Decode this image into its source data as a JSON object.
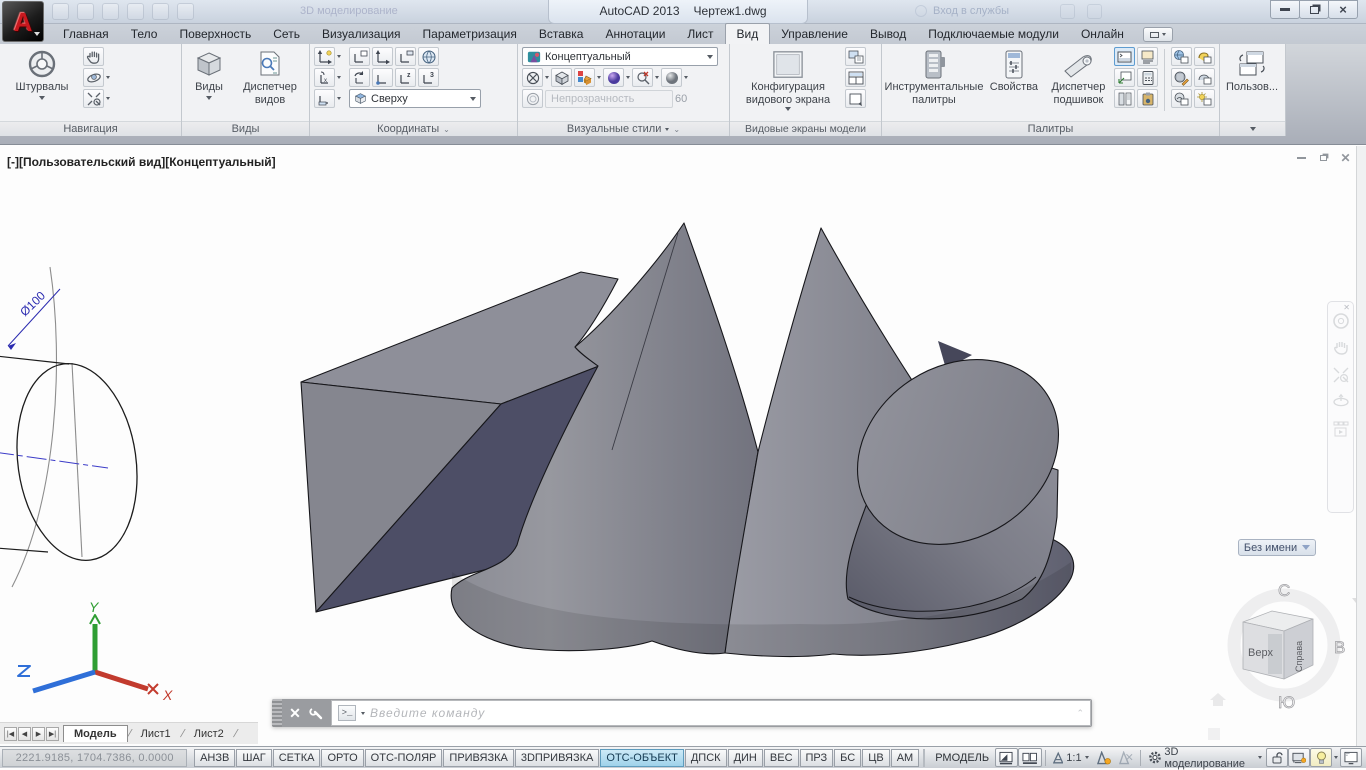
{
  "title_bar": {
    "app_title": "AutoCAD 2013",
    "doc_name": "Чертеж1.dwg",
    "workspace": "3D моделирование",
    "signin": "Вход в службы"
  },
  "ribbon": {
    "tabs": [
      "Главная",
      "Тело",
      "Поверхность",
      "Сеть",
      "Визуализация",
      "Параметризация",
      "Вставка",
      "Аннотации",
      "Лист",
      "Вид",
      "Управление",
      "Вывод",
      "Подключаемые модули",
      "Онлайн"
    ],
    "active_tab": "Вид",
    "panel_navigation": {
      "title": "Навигация",
      "steering_wheels": "Штурвалы"
    },
    "panel_views": {
      "title": "Виды",
      "views": "Виды",
      "view_manager": "Диспетчер видов"
    },
    "panel_coordinates": {
      "title": "Координаты",
      "view_select": "Сверху"
    },
    "panel_visual_styles": {
      "title": "Визуальные стили",
      "style_select": "Концептуальный",
      "opacity_label": "Непрозрачность",
      "opacity_value": "60"
    },
    "panel_model_viewports": {
      "title": "Видовые экраны модели",
      "config": "Конфигурация видового экрана"
    },
    "panel_palettes": {
      "title": "Палитры",
      "tool_palettes": "Инструментальные палитры",
      "properties": "Свойства",
      "sheet_set_manager": "Диспетчер подшивок"
    },
    "panel_user": {
      "user": "Пользов..."
    }
  },
  "viewport": {
    "control_minus": "[-]",
    "control_view": "[Пользовательский вид]",
    "control_style": "[Концептуальный]",
    "dimension_label": "Ø100",
    "viewcube": {
      "ucs_button": "Без имени",
      "north": "С",
      "east": "В",
      "south": "Ю",
      "face_top": "Верх",
      "face_right": "Справа"
    },
    "ucs_axes": {
      "x": "X",
      "y": "Y",
      "z": "Z"
    }
  },
  "command_line": {
    "prompt": ">_",
    "placeholder": "Введите команду"
  },
  "layout_tabs": [
    "Модель",
    "Лист1",
    "Лист2"
  ],
  "status_bar": {
    "coordinates": "2221.9185, 1704.7386, 0.0000",
    "toggles": [
      "АНЗВ",
      "ШАГ",
      "СЕТКА",
      "ОРТО",
      "ОТС-ПОЛЯР",
      "ПРИВЯЗКА",
      "3DПРИВЯЗКА",
      "ОТС-ОБЪЕКТ",
      "ДПСК",
      "ДИН",
      "ВЕС",
      "ПРЗ",
      "БС",
      "ЦВ",
      "АМ"
    ],
    "active_toggle": "ОТС-ОБЪЕКТ",
    "model_space": "РМОДЕЛЬ",
    "annotation_scale": "1:1",
    "workspace": "3D моделирование"
  },
  "colors": {
    "viewport_bg": "#fdfdfd",
    "solid_light": "#95969f",
    "solid_dark": "#4d4e66",
    "edge": "#17171b",
    "active_toggle_bg": "#a9d9ef",
    "dimension_blue": "#2b2bb0",
    "axis_x_red": "#c23b2e",
    "axis_y_green": "#2f9e33",
    "axis_z_blue": "#2f6fd8"
  }
}
